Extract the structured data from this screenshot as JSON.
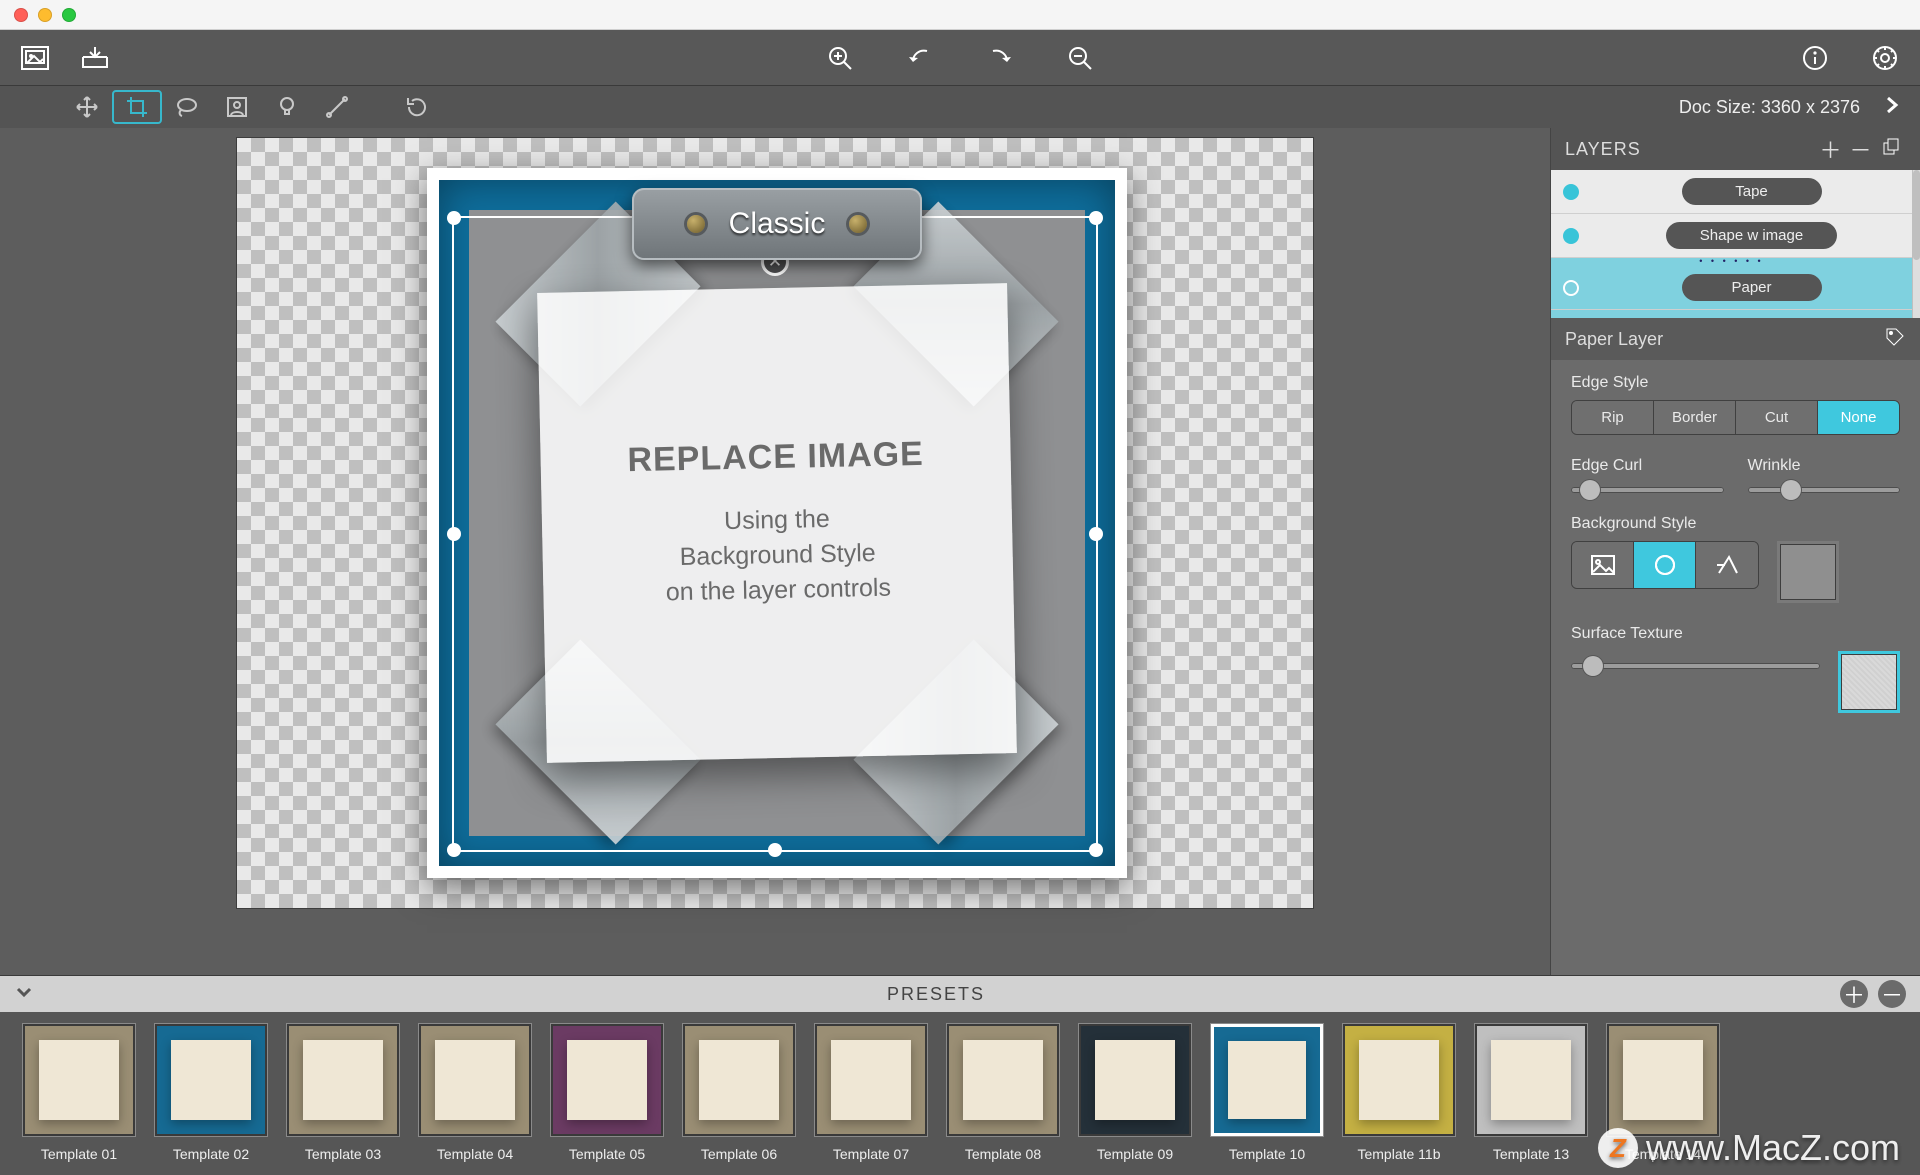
{
  "toolbar": {
    "doc_size": "Doc Size: 3360 x 2376"
  },
  "canvas": {
    "plate_label": "Classic",
    "paper_heading": "REPLACE IMAGE",
    "paper_body": "Using the\nBackground Style\non the layer controls"
  },
  "layers": {
    "title": "LAYERS",
    "items": [
      {
        "name": "Tape",
        "selected": false
      },
      {
        "name": "Shape w image",
        "selected": false
      },
      {
        "name": "Paper",
        "selected": true
      }
    ]
  },
  "layer_inspector": {
    "title": "Paper Layer",
    "edge_style": {
      "label": "Edge Style",
      "options": [
        "Rip",
        "Border",
        "Cut",
        "None"
      ],
      "selected": "None"
    },
    "edge_curl": {
      "label": "Edge Curl",
      "value": 0.08
    },
    "wrinkle": {
      "label": "Wrinkle",
      "value": 0.25
    },
    "background_style": {
      "label": "Background Style",
      "options": [
        "image",
        "color",
        "shape"
      ],
      "selected": "color"
    },
    "surface_texture": {
      "label": "Surface Texture",
      "value": 0.07
    }
  },
  "presets": {
    "title": "PRESETS",
    "items": [
      {
        "label": "Template 01"
      },
      {
        "label": "Template 02"
      },
      {
        "label": "Template 03"
      },
      {
        "label": "Template 04"
      },
      {
        "label": "Template 05"
      },
      {
        "label": "Template 06"
      },
      {
        "label": "Template 07"
      },
      {
        "label": "Template 08"
      },
      {
        "label": "Template 09"
      },
      {
        "label": "Template 10",
        "selected": true
      },
      {
        "label": "Template 11b"
      },
      {
        "label": "Template 13"
      },
      {
        "label": "Template 14"
      }
    ]
  },
  "watermark": "www.MacZ.com",
  "colors": {
    "accent": "#3fc8de",
    "panel": "#6b6b6b",
    "toolbar": "#585858"
  }
}
